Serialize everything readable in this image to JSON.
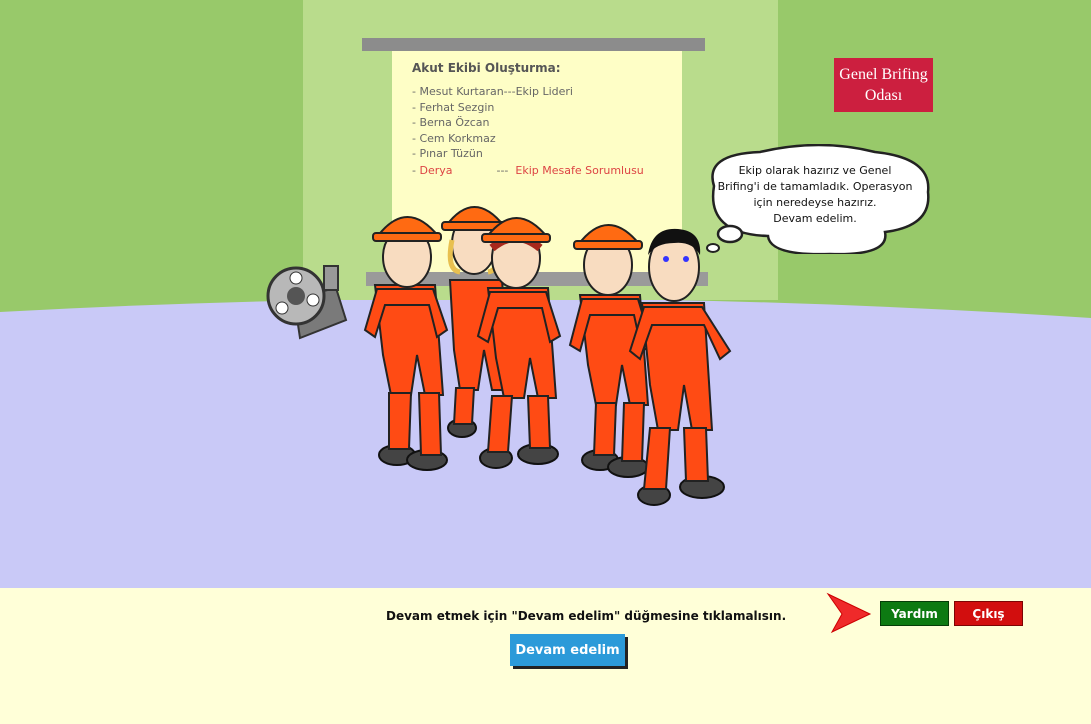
{
  "room": {
    "sign_line1": "Genel Brifing",
    "sign_line2": "Odası"
  },
  "board": {
    "title": "Akut Ekibi Oluşturma:",
    "members": [
      {
        "text": "- Mesut Kurtaran---Ekip Lideri"
      },
      {
        "text": "- Ferhat Sezgin"
      },
      {
        "text": "- Berna Özcan"
      },
      {
        "text": "- Cem Korkmaz"
      },
      {
        "text": "- Pınar Tüzün"
      }
    ],
    "last_member": {
      "prefix": "- ",
      "name": "Derya",
      "sep": "---",
      "role": "Ekip Mesafe Sorumlusu"
    }
  },
  "speech": {
    "line1": "Ekip olarak hazırız ve Genel",
    "line2": "Brifing'i de tamamladık. Operasyon",
    "line3": "için neredeyse hazırız.",
    "line4": "Devam edelim."
  },
  "footer": {
    "instruction": "Devam etmek için \"Devam edelim\" düğmesine tıklamalısın.",
    "continue_label": "Devam edelim",
    "help_label": "Yardım",
    "exit_label": "Çıkış"
  },
  "colors": {
    "wall": "#98c96a",
    "floor": "#c9c9f7",
    "suit": "#ff4b14",
    "helmet": "#ff6a12",
    "sign": "#cc1f3f"
  },
  "icons": {
    "projector": "film-projector-icon",
    "pointer": "red-arrow-icon"
  }
}
